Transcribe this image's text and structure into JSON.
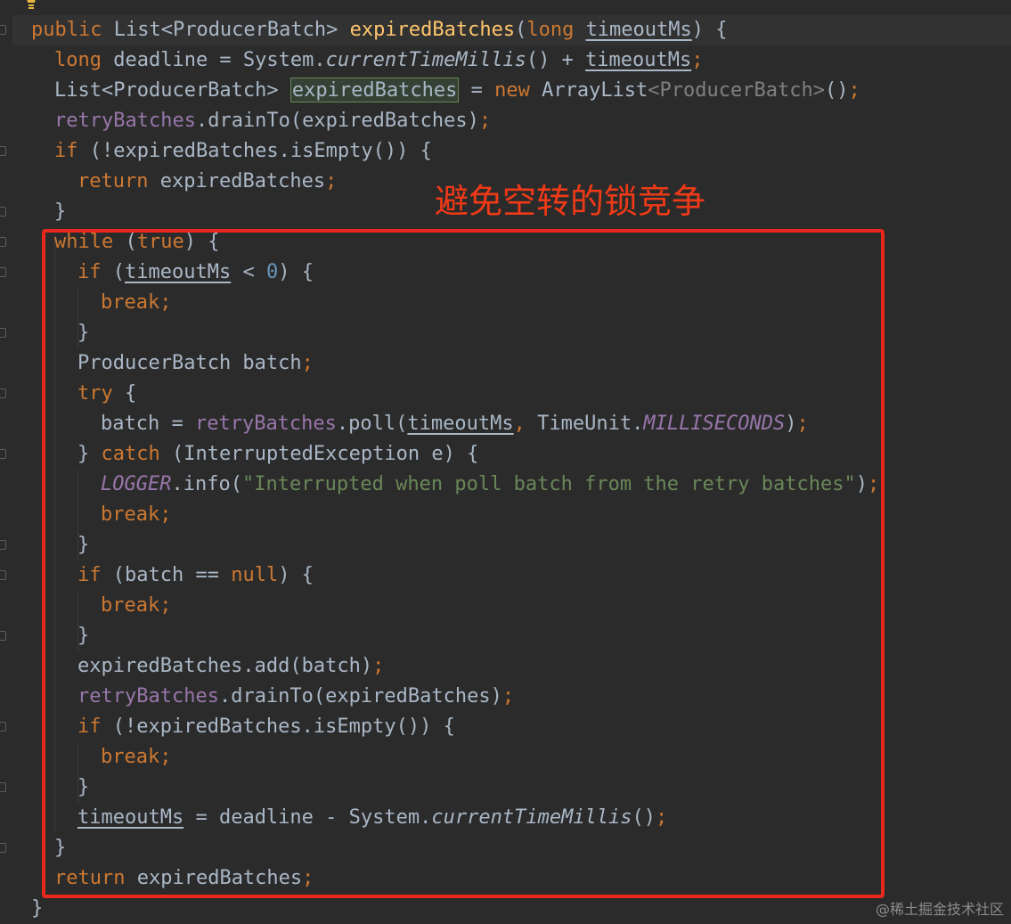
{
  "editor": {
    "theme_colors": {
      "background": "#2b2b2b",
      "keyword": "#cc7832",
      "method_declaration": "#ffc66d",
      "field": "#9876aa",
      "string": "#6a8759",
      "number": "#6897bb",
      "plain": "#a9b7c6"
    },
    "lines": {
      "l1": {
        "kw1": "public",
        "t1": " List<ProducerBatch> ",
        "fn": "expiredBatches",
        "t2": "(",
        "kw2": "long",
        "t3": " ",
        "param": "timeoutMs",
        "t4": ") {"
      },
      "l2": {
        "kw1": "long",
        "t1": " deadline = System.",
        "it": "currentTimeMillis",
        "t2": "() + ",
        "param": "timeoutMs",
        "kw2": ";"
      },
      "l3": {
        "t1": "List<ProducerBatch> ",
        "boxed": "expiredBatches",
        "t2": " = ",
        "kw1": "new",
        "t3": " ArrayList",
        "gen": "<ProducerBatch>",
        "t4": "()",
        "kw2": ";"
      },
      "l4": {
        "field": "retryBatches",
        "t1": ".drainTo(expiredBatches)",
        "kw1": ";"
      },
      "l5": {
        "kw1": "if",
        "t1": " (!expiredBatches.isEmpty()) {"
      },
      "l6": {
        "kw1": "return",
        "t1": " expiredBatches",
        "kw2": ";"
      },
      "l7": {
        "t1": "}"
      },
      "l8": {
        "kw1": "while",
        "t1": " (",
        "kw2": "true",
        "t2": ") {"
      },
      "l9": {
        "kw1": "if",
        "t1": " (",
        "param": "timeoutMs",
        "t2": " < ",
        "num": "0",
        "t3": ") {"
      },
      "l10": {
        "kw1": "break;"
      },
      "l11": {
        "t1": "}"
      },
      "l12": {
        "t1": "ProducerBatch batch",
        "kw1": ";"
      },
      "l13": {
        "kw1": "try",
        "t1": " {"
      },
      "l14": {
        "t1": "batch = ",
        "field": "retryBatches",
        "t2": ".poll(",
        "param": "timeoutMs",
        "kw1": ",",
        "t3": " TimeUnit.",
        "fieldit": "MILLISECONDS",
        "t4": ")",
        "kw2": ";"
      },
      "l15": {
        "t1": "} ",
        "kw1": "catch",
        "t2": " (InterruptedException e) {"
      },
      "l16": {
        "fieldit": "LOGGER",
        "t1": ".info(",
        "str": "\"Interrupted when poll batch from the retry batches\"",
        "t2": ")",
        "kw1": ";"
      },
      "l17": {
        "kw1": "break;"
      },
      "l18": {
        "t1": "}"
      },
      "l19": {
        "kw1": "if",
        "t1": " (batch == ",
        "kw2": "null",
        "t2": ") {"
      },
      "l20": {
        "kw1": "break;"
      },
      "l21": {
        "t1": "}"
      },
      "l22": {
        "t1": "expiredBatches.add(batch)",
        "kw1": ";"
      },
      "l23": {
        "field": "retryBatches",
        "t1": ".drainTo(expiredBatches)",
        "kw1": ";"
      },
      "l24": {
        "kw1": "if",
        "t1": " (!expiredBatches.isEmpty()) {"
      },
      "l25": {
        "kw1": "break;"
      },
      "l26": {
        "t1": "}"
      },
      "l27": {
        "param": "timeoutMs",
        "t1": " = deadline - System.",
        "it": "currentTimeMillis",
        "t2": "()",
        "kw1": ";"
      },
      "l28": {
        "t1": "}"
      },
      "l29": {
        "kw1": "return",
        "t1": " expiredBatches",
        "kw2": ";"
      },
      "l30": {
        "t1": "}"
      }
    }
  },
  "annotation": {
    "text": "避免空转的锁竞争",
    "color": "#f03a17",
    "box_color": "#e8281c"
  },
  "watermark": {
    "text": "@稀土掘金技术社区"
  }
}
